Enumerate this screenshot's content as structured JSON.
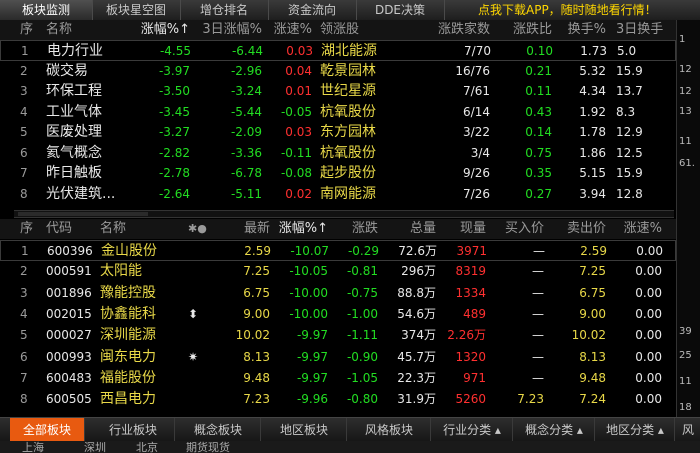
{
  "top_tabs": [
    {
      "label": "板块监测",
      "active": true
    },
    {
      "label": "板块星空图",
      "active": false
    },
    {
      "label": "增仓排名",
      "active": false
    },
    {
      "label": "资金流向",
      "active": false
    },
    {
      "label": "DDE决策",
      "active": false
    }
  ],
  "promo": "点我下载APP，随时随地看行情！",
  "sector_table": {
    "headers": {
      "idx": "序",
      "name": "名称",
      "chg": "涨幅%↑",
      "chg3": "3日涨幅%",
      "speed": "涨速%",
      "lead": "领涨股",
      "updown": "涨跌家数",
      "ratio": "涨跌比",
      "turnover": "换手%",
      "turnover3": "3日换手"
    },
    "rows": [
      {
        "idx": "1",
        "name": "电力行业",
        "chg": "-4.55",
        "chg3": "-6.44",
        "speed": "0.03",
        "lead": "湖北能源",
        "updown": "7/70",
        "ratio": "0.10",
        "turnover": "1.73",
        "turnover3": "5.0"
      },
      {
        "idx": "2",
        "name": "碳交易",
        "chg": "-3.97",
        "chg3": "-2.96",
        "speed": "0.04",
        "lead": "乾景园林",
        "updown": "16/76",
        "ratio": "0.21",
        "turnover": "5.32",
        "turnover3": "15.9"
      },
      {
        "idx": "3",
        "name": "环保工程",
        "chg": "-3.50",
        "chg3": "-3.24",
        "speed": "0.01",
        "lead": "世纪星源",
        "updown": "7/61",
        "ratio": "0.11",
        "turnover": "4.34",
        "turnover3": "13.7"
      },
      {
        "idx": "4",
        "name": "工业气体",
        "chg": "-3.45",
        "chg3": "-5.44",
        "speed": "-0.05",
        "lead": "杭氧股份",
        "updown": "6/14",
        "ratio": "0.43",
        "turnover": "1.92",
        "turnover3": "8.3"
      },
      {
        "idx": "5",
        "name": "医废处理",
        "chg": "-3.27",
        "chg3": "-2.09",
        "speed": "0.03",
        "lead": "东方园林",
        "updown": "3/22",
        "ratio": "0.14",
        "turnover": "1.78",
        "turnover3": "12.9"
      },
      {
        "idx": "6",
        "name": "氦气概念",
        "chg": "-2.82",
        "chg3": "-3.36",
        "speed": "-0.11",
        "lead": "杭氧股份",
        "updown": "3/4",
        "ratio": "0.75",
        "turnover": "1.86",
        "turnover3": "12.5"
      },
      {
        "idx": "7",
        "name": "昨日触板",
        "chg": "-2.78",
        "chg3": "-6.78",
        "speed": "-0.08",
        "lead": "起步股份",
        "updown": "9/26",
        "ratio": "0.35",
        "turnover": "5.15",
        "turnover3": "15.9"
      },
      {
        "idx": "8",
        "name": "光伏建筑...",
        "chg": "-2.64",
        "chg3": "-5.11",
        "speed": "0.02",
        "lead": "南网能源",
        "updown": "7/26",
        "ratio": "0.27",
        "turnover": "3.94",
        "turnover3": "12.8"
      }
    ]
  },
  "stock_table": {
    "headers": {
      "idx": "序",
      "code": "代码",
      "name": "名称",
      "mark": "✱●",
      "price": "最新",
      "chg": "涨幅%↑",
      "change": "涨跌",
      "volume": "总量",
      "curvol": "现量",
      "bid": "买入价",
      "ask": "卖出价",
      "speed": "涨速%"
    },
    "rows": [
      {
        "idx": "1",
        "code": "600396",
        "name": "金山股份",
        "mark": "",
        "price": "2.59",
        "chg": "-10.07",
        "change": "-0.29",
        "volume": "72.6万",
        "curvol": "3971",
        "bid": "—",
        "ask": "2.59",
        "speed": "0.00"
      },
      {
        "idx": "2",
        "code": "000591",
        "name": "太阳能",
        "mark": "",
        "price": "7.25",
        "chg": "-10.05",
        "change": "-0.81",
        "volume": "296万",
        "curvol": "8319",
        "bid": "—",
        "ask": "7.25",
        "speed": "0.00"
      },
      {
        "idx": "3",
        "code": "001896",
        "name": "豫能控股",
        "mark": "",
        "price": "6.75",
        "chg": "-10.00",
        "change": "-0.75",
        "volume": "88.8万",
        "curvol": "1334",
        "bid": "—",
        "ask": "6.75",
        "speed": "0.00"
      },
      {
        "idx": "4",
        "code": "002015",
        "name": "协鑫能科",
        "mark": "⬍",
        "price": "9.00",
        "chg": "-10.00",
        "change": "-1.00",
        "volume": "54.6万",
        "curvol": "489",
        "bid": "—",
        "ask": "9.00",
        "speed": "0.00"
      },
      {
        "idx": "5",
        "code": "000027",
        "name": "深圳能源",
        "mark": "",
        "price": "10.02",
        "chg": "-9.97",
        "change": "-1.11",
        "volume": "374万",
        "curvol": "2.26万",
        "bid": "—",
        "ask": "10.02",
        "speed": "0.00"
      },
      {
        "idx": "6",
        "code": "000993",
        "name": "闽东电力",
        "mark": "✷",
        "price": "8.13",
        "chg": "-9.97",
        "change": "-0.90",
        "volume": "45.7万",
        "curvol": "1320",
        "bid": "—",
        "ask": "8.13",
        "speed": "0.00"
      },
      {
        "idx": "7",
        "code": "600483",
        "name": "福能股份",
        "mark": "",
        "price": "9.48",
        "chg": "-9.97",
        "change": "-1.05",
        "volume": "22.3万",
        "curvol": "971",
        "bid": "—",
        "ask": "9.48",
        "speed": "0.00"
      },
      {
        "idx": "8",
        "code": "600505",
        "name": "西昌电力",
        "mark": "",
        "price": "7.23",
        "chg": "-9.96",
        "change": "-0.80",
        "volume": "31.9万",
        "curvol": "5260",
        "bid": "7.23",
        "ask": "7.24",
        "speed": "0.00"
      }
    ]
  },
  "right_strip": [
    "1",
    "12",
    "12",
    "13",
    "11",
    "61.",
    "39",
    "25",
    "11",
    "18"
  ],
  "bottom_tabs": [
    {
      "label": "全部板块",
      "active": true
    },
    {
      "label": "行业板块",
      "active": false
    },
    {
      "label": "概念板块",
      "active": false
    },
    {
      "label": "地区板块",
      "active": false
    },
    {
      "label": "风格板块",
      "active": false
    },
    {
      "label": "行业分类 ▴",
      "active": false
    },
    {
      "label": "概念分类 ▴",
      "active": false
    },
    {
      "label": "地区分类 ▴",
      "active": false
    },
    {
      "label": "风",
      "active": false
    }
  ],
  "bottom2": [
    "上海",
    "深圳",
    "北京",
    "期货现货"
  ]
}
